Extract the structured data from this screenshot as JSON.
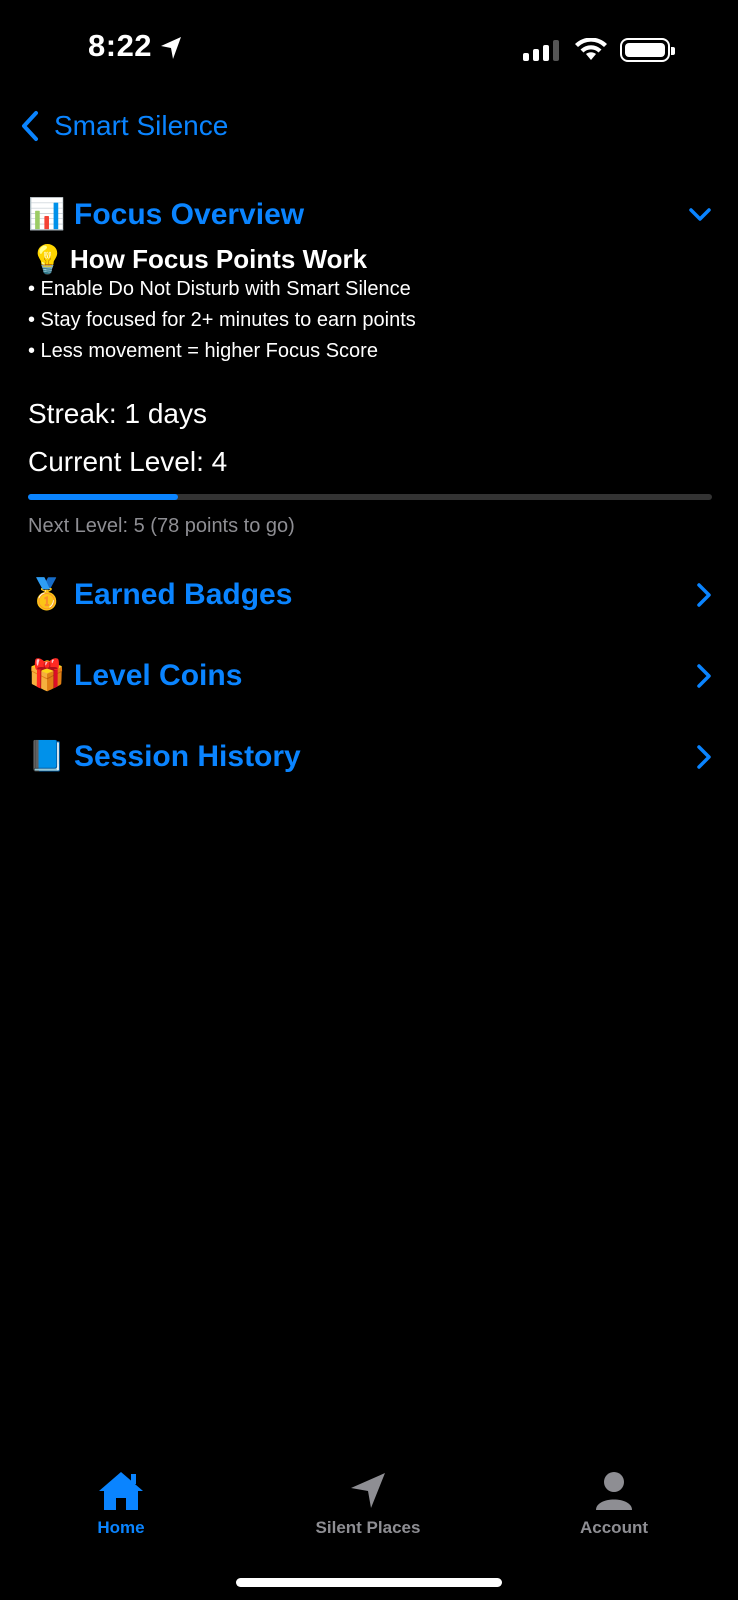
{
  "status_bar": {
    "time": "8:22"
  },
  "nav": {
    "back_label": "Smart Silence"
  },
  "focus_overview": {
    "emoji": "📊",
    "title": "Focus Overview",
    "howto_emoji": "💡",
    "howto_title": "How Focus Points Work",
    "bullets": [
      "• Enable Do Not Disturb with Smart Silence",
      "• Stay focused for 2+ minutes to earn points",
      "• Less movement = higher Focus Score"
    ],
    "streak": "Streak: 1 days",
    "current_level": "Current Level: 4",
    "progress_fraction": 0.22,
    "next_level": "Next Level: 5 (78 points to go)"
  },
  "sections": [
    {
      "emoji": "🥇",
      "title": "Earned Badges"
    },
    {
      "emoji": "🎁",
      "title": "Level Coins"
    },
    {
      "emoji": "📘",
      "title": "Session History"
    }
  ],
  "tabs": [
    {
      "label": "Home",
      "icon": "house-icon",
      "active": true
    },
    {
      "label": "Silent Places",
      "icon": "location-arrow-icon",
      "active": false
    },
    {
      "label": "Account",
      "icon": "person-icon",
      "active": false
    }
  ],
  "colors": {
    "accent": "#0a84ff",
    "inactive": "#8e8e93",
    "background": "#000000"
  }
}
